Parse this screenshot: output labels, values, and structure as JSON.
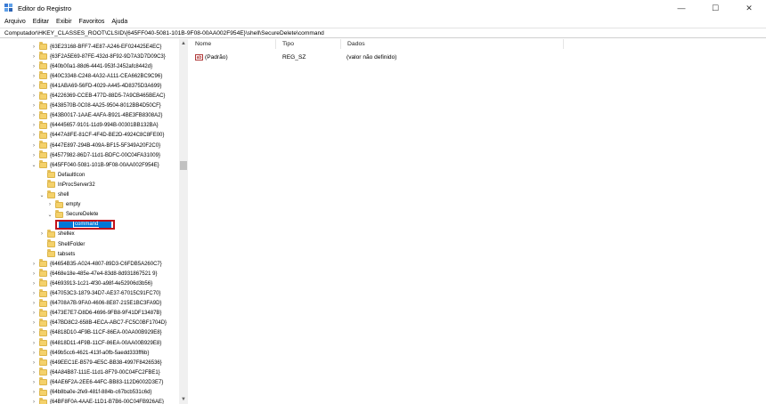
{
  "window": {
    "title": "Editor do Registro",
    "minimize": "—",
    "maximize": "☐",
    "close": "✕"
  },
  "menu": [
    "Arquivo",
    "Editar",
    "Exibir",
    "Favoritos",
    "Ajuda"
  ],
  "address": "Computador\\HKEY_CLASSES_ROOT\\CLSID\\{645FF040-5081-101B-9F08-00AA002F954E}\\shell\\SecureDelete\\command",
  "tree": [
    {
      "label": "{63E23168-BFF7-4E87-A246-EF024425E4EC}",
      "indent": 0,
      "expander": "›"
    },
    {
      "label": "{63F2A5E69-87FE-432d-8F92-9D7A3D7D09C3}",
      "indent": 0,
      "expander": "›"
    },
    {
      "label": "{640b00a1-88d6-4441-953f-2452afc8442d}",
      "indent": 0,
      "expander": "›"
    },
    {
      "label": "{640C3348-C248-4A32-A111-CEA662BC9C96}",
      "indent": 0,
      "expander": "›"
    },
    {
      "label": "{641ABA69-56FD-4029-A445-4D8375D3A699}",
      "indent": 0,
      "expander": "›"
    },
    {
      "label": "{64226369-CCEB-477D-88D5-7A9CB465BEAC}",
      "indent": 0,
      "expander": "›"
    },
    {
      "label": "{6438570B-0C08-4A25-9504-8012BB4D50CF}",
      "indent": 0,
      "expander": "›"
    },
    {
      "label": "{643B0017-1AAE-4AFA-B921-4BE3FB8308A2}",
      "indent": 0,
      "expander": "›"
    },
    {
      "label": "{64445657-9101-11d9-994B-00301BB132BA}",
      "indent": 0,
      "expander": "›"
    },
    {
      "label": "{6447A8FE-81CF-4F4D-BE2D-4924C8C8FE00}",
      "indent": 0,
      "expander": "›"
    },
    {
      "label": "{6447E897-294B-409A-BF15-5F349A20F2C0}",
      "indent": 0,
      "expander": "›"
    },
    {
      "label": "{64577982-86D7-11d1-BDFC-00C04FA31009}",
      "indent": 0,
      "expander": "›"
    },
    {
      "label": "{645FF040-5081-101B-9F08-00AA002F954E}",
      "indent": 0,
      "expander": "⌄"
    },
    {
      "label": "DefaultIcon",
      "indent": 1,
      "expander": ""
    },
    {
      "label": "InProcServer32",
      "indent": 1,
      "expander": ""
    },
    {
      "label": "shell",
      "indent": 1,
      "expander": "⌄"
    },
    {
      "label": "empty",
      "indent": 2,
      "expander": "›"
    },
    {
      "label": "SecureDelete",
      "indent": 2,
      "expander": "⌄"
    },
    {
      "label": "command",
      "indent": 3,
      "expander": "",
      "selected": true
    },
    {
      "label": "shellex",
      "indent": 1,
      "expander": "›"
    },
    {
      "label": "ShellFolder",
      "indent": 1,
      "expander": ""
    },
    {
      "label": "tabsets",
      "indent": 1,
      "expander": ""
    },
    {
      "label": "{64654B35-A024-4807-89D3-C6FDB5A260C7}",
      "indent": 0,
      "expander": "›"
    },
    {
      "label": "{6468e18e-485e-47e4-83d8-8d931867521 9}",
      "indent": 0,
      "expander": "›"
    },
    {
      "label": "{64693913-1c21-4f30-a98f-4e52906d3b56}",
      "indent": 0,
      "expander": "›"
    },
    {
      "label": "{647053C3-1879-34D7-AE37-67015C91FC70}",
      "indent": 0,
      "expander": "›"
    },
    {
      "label": "{64708A7B-9FA0-4606-8E87-215E1BC3FA9D}",
      "indent": 0,
      "expander": "›"
    },
    {
      "label": "{6473E7E7-D8D6-4696-9FB8-9F41DF13487B}",
      "indent": 0,
      "expander": "›"
    },
    {
      "label": "{647BD8C2-658B-4ECA-ABC7-FC5C0BF1704D}",
      "indent": 0,
      "expander": "›"
    },
    {
      "label": "{64818D10-4F9B-11CF-86EA-00AA00B929E8}",
      "indent": 0,
      "expander": "›"
    },
    {
      "label": "{64818D11-4F9B-11CF-86EA-00AA00B929E8}",
      "indent": 0,
      "expander": "›"
    },
    {
      "label": "{649b5cc6-4621-413f-a0fb-5aedd333ff6b}",
      "indent": 0,
      "expander": "›"
    },
    {
      "label": "{649EEC1E-B579-4E5C-BB38-4997F8426536}",
      "indent": 0,
      "expander": "›"
    },
    {
      "label": "{64A84B87-111E-11d1-8F79-00C04FC2FBE1}",
      "indent": 0,
      "expander": "›"
    },
    {
      "label": "{64AE6F2A-2EE6-44FC-BB83-112D6002D3E7}",
      "indent": 0,
      "expander": "›"
    },
    {
      "label": "{64b8ba0e-2fe9-481f-884b-c67bcb531c6d}",
      "indent": 0,
      "expander": "›"
    },
    {
      "label": "{64BF8F0A-4AAE-11D1-B7B6-00C04FB926AE}",
      "indent": 0,
      "expander": "›"
    }
  ],
  "list": {
    "headers": {
      "name": "Nome",
      "type": "Tipo",
      "data": "Dados"
    },
    "rows": [
      {
        "icon": "ab",
        "name": "(Padrão)",
        "type": "REG_SZ",
        "data": "(valor não definido)"
      }
    ]
  },
  "colors": {
    "selection": "#0078d7",
    "highlight_border": "#c1121b",
    "folder": "#f4d16b"
  }
}
